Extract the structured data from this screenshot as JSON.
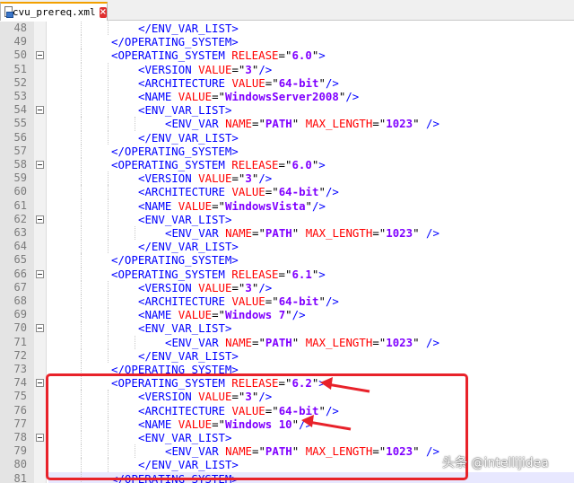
{
  "tab": {
    "filename": "cvu_prereq.xml",
    "close_glyph": "×"
  },
  "lines": [
    {
      "num": "48",
      "indent": 3,
      "text": "</ENV_VAR_LIST>",
      "type": "close"
    },
    {
      "num": "49",
      "indent": 2,
      "text": "</OPERATING_SYSTEM>",
      "type": "close"
    },
    {
      "num": "50",
      "indent": 2,
      "fold": true,
      "tag": "OPERATING_SYSTEM",
      "attrs": [
        {
          "name": "RELEASE",
          "value": "6.0"
        }
      ],
      "end": ">",
      "type": "open"
    },
    {
      "num": "51",
      "indent": 3,
      "tag": "VERSION",
      "attrs": [
        {
          "name": "VALUE",
          "value": "3"
        }
      ],
      "end": "/>",
      "type": "open"
    },
    {
      "num": "52",
      "indent": 3,
      "tag": "ARCHITECTURE",
      "attrs": [
        {
          "name": "VALUE",
          "value": "64-bit"
        }
      ],
      "end": "/>",
      "type": "open"
    },
    {
      "num": "53",
      "indent": 3,
      "tag": "NAME",
      "attrs": [
        {
          "name": "VALUE",
          "value": "WindowsServer2008"
        }
      ],
      "end": "/>",
      "type": "open"
    },
    {
      "num": "54",
      "indent": 3,
      "fold": true,
      "text": "<ENV_VAR_LIST>",
      "type": "close"
    },
    {
      "num": "55",
      "indent": 4,
      "tag": "ENV_VAR",
      "attrs": [
        {
          "name": "NAME",
          "value": "PATH"
        },
        {
          "name": "MAX_LENGTH",
          "value": "1023"
        }
      ],
      "end": " />",
      "type": "open"
    },
    {
      "num": "56",
      "indent": 3,
      "text": "</ENV_VAR_LIST>",
      "type": "close"
    },
    {
      "num": "57",
      "indent": 2,
      "text": "</OPERATING_SYSTEM>",
      "type": "close"
    },
    {
      "num": "58",
      "indent": 2,
      "fold": true,
      "tag": "OPERATING_SYSTEM",
      "attrs": [
        {
          "name": "RELEASE",
          "value": "6.0"
        }
      ],
      "end": ">",
      "type": "open"
    },
    {
      "num": "59",
      "indent": 3,
      "tag": "VERSION",
      "attrs": [
        {
          "name": "VALUE",
          "value": "3"
        }
      ],
      "end": "/>",
      "type": "open"
    },
    {
      "num": "60",
      "indent": 3,
      "tag": "ARCHITECTURE",
      "attrs": [
        {
          "name": "VALUE",
          "value": "64-bit"
        }
      ],
      "end": "/>",
      "type": "open"
    },
    {
      "num": "61",
      "indent": 3,
      "tag": "NAME",
      "attrs": [
        {
          "name": "VALUE",
          "value": "WindowsVista"
        }
      ],
      "end": "/>",
      "type": "open"
    },
    {
      "num": "62",
      "indent": 3,
      "fold": true,
      "text": "<ENV_VAR_LIST>",
      "type": "close"
    },
    {
      "num": "63",
      "indent": 4,
      "tag": "ENV_VAR",
      "attrs": [
        {
          "name": "NAME",
          "value": "PATH"
        },
        {
          "name": "MAX_LENGTH",
          "value": "1023"
        }
      ],
      "end": " />",
      "type": "open"
    },
    {
      "num": "64",
      "indent": 3,
      "text": "</ENV_VAR_LIST>",
      "type": "close"
    },
    {
      "num": "65",
      "indent": 2,
      "text": "</OPERATING_SYSTEM>",
      "type": "close"
    },
    {
      "num": "66",
      "indent": 2,
      "fold": true,
      "tag": "OPERATING_SYSTEM",
      "attrs": [
        {
          "name": "RELEASE",
          "value": "6.1"
        }
      ],
      "end": ">",
      "type": "open"
    },
    {
      "num": "67",
      "indent": 3,
      "tag": "VERSION",
      "attrs": [
        {
          "name": "VALUE",
          "value": "3"
        }
      ],
      "end": "/>",
      "type": "open"
    },
    {
      "num": "68",
      "indent": 3,
      "tag": "ARCHITECTURE",
      "attrs": [
        {
          "name": "VALUE",
          "value": "64-bit"
        }
      ],
      "end": "/>",
      "type": "open"
    },
    {
      "num": "69",
      "indent": 3,
      "tag": "NAME",
      "attrs": [
        {
          "name": "VALUE",
          "value": "Windows 7"
        }
      ],
      "end": "/>",
      "type": "open"
    },
    {
      "num": "70",
      "indent": 3,
      "fold": true,
      "text": "<ENV_VAR_LIST>",
      "type": "close"
    },
    {
      "num": "71",
      "indent": 4,
      "tag": "ENV_VAR",
      "attrs": [
        {
          "name": "NAME",
          "value": "PATH"
        },
        {
          "name": "MAX_LENGTH",
          "value": "1023"
        }
      ],
      "end": " />",
      "type": "open"
    },
    {
      "num": "72",
      "indent": 3,
      "text": "</ENV_VAR_LIST>",
      "type": "close"
    },
    {
      "num": "73",
      "indent": 2,
      "text": "</OPERATING_SYSTEM>",
      "type": "close"
    },
    {
      "num": "74",
      "indent": 2,
      "fold": true,
      "tag": "OPERATING_SYSTEM",
      "attrs": [
        {
          "name": "RELEASE",
          "value": "6.2"
        }
      ],
      "end": ">",
      "type": "open"
    },
    {
      "num": "75",
      "indent": 3,
      "tag": "VERSION",
      "attrs": [
        {
          "name": "VALUE",
          "value": "3"
        }
      ],
      "end": "/>",
      "type": "open"
    },
    {
      "num": "76",
      "indent": 3,
      "tag": "ARCHITECTURE",
      "attrs": [
        {
          "name": "VALUE",
          "value": "64-bit"
        }
      ],
      "end": "/>",
      "type": "open"
    },
    {
      "num": "77",
      "indent": 3,
      "tag": "NAME",
      "attrs": [
        {
          "name": "VALUE",
          "value": "Windows 10"
        }
      ],
      "end": "/>",
      "type": "open"
    },
    {
      "num": "78",
      "indent": 3,
      "fold": true,
      "text": "<ENV_VAR_LIST>",
      "type": "close"
    },
    {
      "num": "79",
      "indent": 4,
      "tag": "ENV_VAR",
      "attrs": [
        {
          "name": "NAME",
          "value": "PATH"
        },
        {
          "name": "MAX_LENGTH",
          "value": "1023"
        }
      ],
      "end": " />",
      "type": "open"
    },
    {
      "num": "80",
      "indent": 3,
      "text": "</ENV_VAR_LIST>",
      "type": "close"
    },
    {
      "num": "81",
      "indent": 2,
      "text": "</OPERATING_SYSTEM>",
      "type": "close",
      "current": true
    }
  ],
  "highlight_color": "#e8222a",
  "watermark": "头条 @intellijidea"
}
